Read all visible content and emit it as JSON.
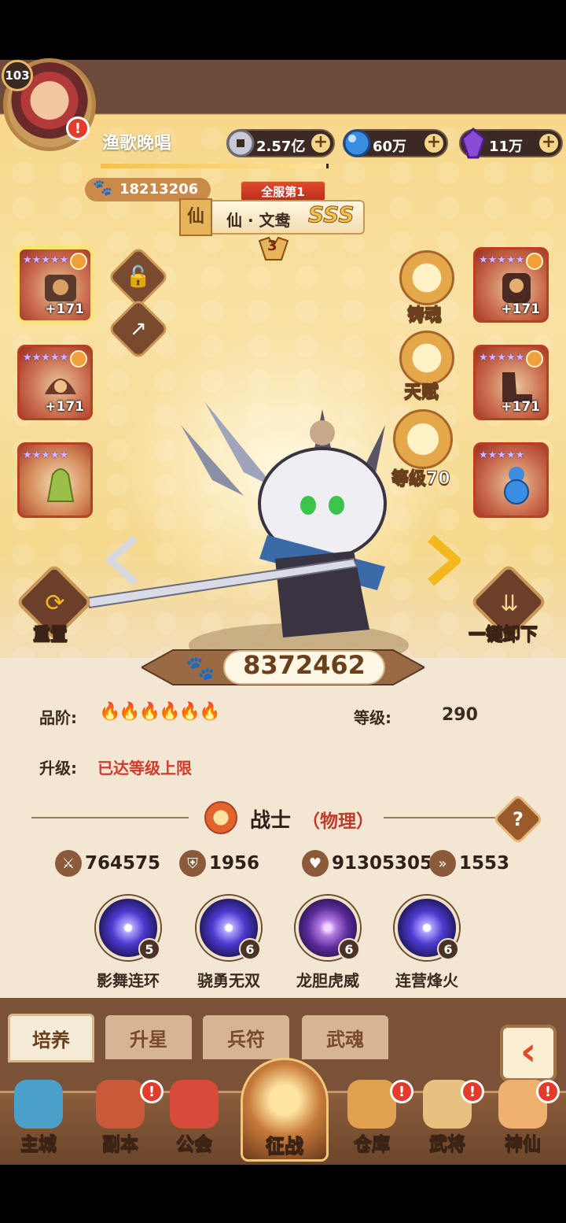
{
  "player": {
    "level": "103",
    "name": "渔歌晚唱",
    "power": "18213206",
    "exp_progress": 0.99
  },
  "currencies": [
    {
      "name": "silver-coin",
      "value": "2.57亿",
      "color": "#b9b9c6"
    },
    {
      "name": "blue-orb",
      "value": "60万",
      "color": "#3a8de0"
    },
    {
      "name": "purple-crystal",
      "value": "11万",
      "color": "#8a4ad6"
    }
  ],
  "hero": {
    "server_rank": "全服第1",
    "race_badge": "仙",
    "name": "仙 · 文鸯",
    "grade": "SSS",
    "star_level": "3",
    "combat_power": "8372462",
    "quality_label": "品阶:",
    "quality_flames": "🔥🔥🔥🔥🔥🔥",
    "level_label": "等级:",
    "level": "290",
    "upgrade_label": "升级:",
    "upgrade_status": "已达等级上限",
    "class_name": "战士",
    "class_type": "（物理）",
    "stats": {
      "attack": "764575",
      "defense": "1956",
      "hp": "91305305",
      "speed": "1553"
    }
  },
  "equipment_left": [
    {
      "level": "+171",
      "active": true
    },
    {
      "level": "+171",
      "active": false
    },
    {
      "level": "",
      "active": false
    }
  ],
  "equipment_right": [
    {
      "level": "+171"
    },
    {
      "level": "+171"
    },
    {
      "level": ""
    }
  ],
  "features": {
    "forge_soul": "铸魂",
    "talent": "天赋",
    "level": "等级70"
  },
  "actions": {
    "reset": "重置",
    "unequip_all": "一键卸下"
  },
  "skills": [
    {
      "name": "影舞连环",
      "level": "5"
    },
    {
      "name": "骁勇无双",
      "level": "6"
    },
    {
      "name": "龙胆虎威",
      "level": "6"
    },
    {
      "name": "连营烽火",
      "level": "6"
    }
  ],
  "tabs": [
    "培养",
    "升星",
    "兵符",
    "武魂"
  ],
  "nav": [
    {
      "label": "主城",
      "alert": false,
      "color": "#4aa0c8"
    },
    {
      "label": "副本",
      "alert": true,
      "color": "#c85a3a"
    },
    {
      "label": "公会",
      "alert": false,
      "color": "#d84a3a"
    },
    {
      "label": "仓库",
      "alert": true,
      "color": "#e0a050"
    },
    {
      "label": "武将",
      "alert": true,
      "color": "#e8c080"
    },
    {
      "label": "神仙",
      "alert": true,
      "color": "#f0b070"
    }
  ],
  "nav_center": "征战"
}
